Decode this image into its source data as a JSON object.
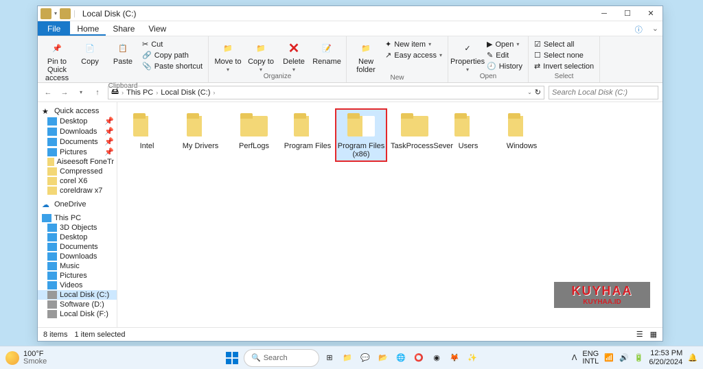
{
  "window": {
    "title": "Local Disk (C:)"
  },
  "menubar": {
    "file": "File",
    "home": "Home",
    "share": "Share",
    "view": "View"
  },
  "ribbon": {
    "pin": "Pin to Quick access",
    "copy": "Copy",
    "paste": "Paste",
    "cut": "Cut",
    "copy_path": "Copy path",
    "paste_shortcut": "Paste shortcut",
    "clipboard": "Clipboard",
    "move_to": "Move to",
    "copy_to": "Copy to",
    "delete": "Delete",
    "rename": "Rename",
    "organize": "Organize",
    "new_folder": "New folder",
    "new_item": "New item",
    "easy_access": "Easy access",
    "new": "New",
    "properties": "Properties",
    "open_btn": "Open",
    "edit": "Edit",
    "history": "History",
    "open": "Open",
    "select_all": "Select all",
    "select_none": "Select none",
    "invert": "Invert selection",
    "select": "Select"
  },
  "breadcrumb": {
    "p1": "This PC",
    "p2": "Local Disk (C:)"
  },
  "search_placeholder": "Search Local Disk (C:)",
  "tree": {
    "quick": "Quick access",
    "desktop": "Desktop",
    "downloads": "Downloads",
    "documents": "Documents",
    "pictures": "Pictures",
    "aiseesoft": "Aiseesoft FoneTr",
    "compressed": "Compressed",
    "corelx6": "corel X6",
    "coreldraw": "coreldraw x7",
    "onedrive": "OneDrive",
    "thispc": "This PC",
    "objects3d": "3D Objects",
    "tpdesktop": "Desktop",
    "tpdocs": "Documents",
    "tpdown": "Downloads",
    "music": "Music",
    "tppics": "Pictures",
    "videos": "Videos",
    "localc": "Local Disk (C:)",
    "softd": "Software (D:)",
    "localf": "Local Disk (F:)"
  },
  "folders": [
    {
      "name": "Intel"
    },
    {
      "name": "My Drivers"
    },
    {
      "name": "PerfLogs"
    },
    {
      "name": "Program Files"
    },
    {
      "name": "Program Files (x86)",
      "selected": true
    },
    {
      "name": "TaskProcessSever"
    },
    {
      "name": "Users"
    },
    {
      "name": "Windows"
    }
  ],
  "status": {
    "items": "8 items",
    "selected": "1 item selected"
  },
  "watermark": {
    "line1": "KUYHAA",
    "line2": "KUYHAA.ID"
  },
  "taskbar": {
    "temp": "100°F",
    "cond": "Smoke",
    "search": "Search",
    "lang1": "ENG",
    "lang2": "INTL",
    "time": "12:53 PM",
    "date": "6/20/2024"
  }
}
